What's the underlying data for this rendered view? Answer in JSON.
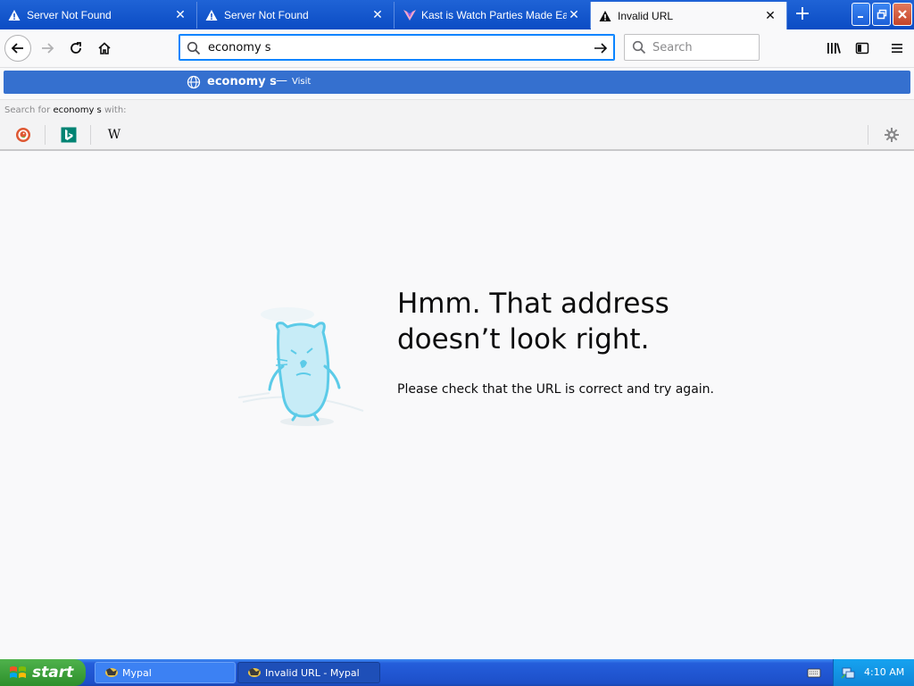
{
  "tabs": [
    {
      "label": "Server Not Found",
      "icon": "warning-icon",
      "active": false
    },
    {
      "label": "Server Not Found",
      "icon": "warning-icon",
      "active": false
    },
    {
      "label": "Kast is Watch Parties Made Easy",
      "icon": "kast-logo-icon",
      "active": false
    },
    {
      "label": "Invalid URL",
      "icon": "warning-icon",
      "active": true
    }
  ],
  "navbar": {
    "url_value": "economy s",
    "search_placeholder": "Search"
  },
  "suggestion": {
    "visit_text": "economy s",
    "dash": "—",
    "visit_label": "Visit"
  },
  "search_with": {
    "prefix": "Search for",
    "query": "economy s",
    "suffix": "with:",
    "engines": [
      "DuckDuckGo",
      "Bing",
      "Wikipedia"
    ],
    "wikipedia_glyph": "W"
  },
  "error_page": {
    "title": "Hmm. That address doesn’t look right.",
    "description": "Please check that the URL is correct and try again."
  },
  "taskbar": {
    "start_label": "start",
    "tasks": [
      {
        "label": "Mypal"
      },
      {
        "label": "Invalid URL - Mypal"
      }
    ],
    "clock": "4:10 AM"
  },
  "colors": {
    "titlebar": "#0b4cc4",
    "accent": "#0a84ff",
    "suggestion_highlight": "#3570cf",
    "taskbar": "#245edb",
    "start_green": "#3c9a37"
  }
}
